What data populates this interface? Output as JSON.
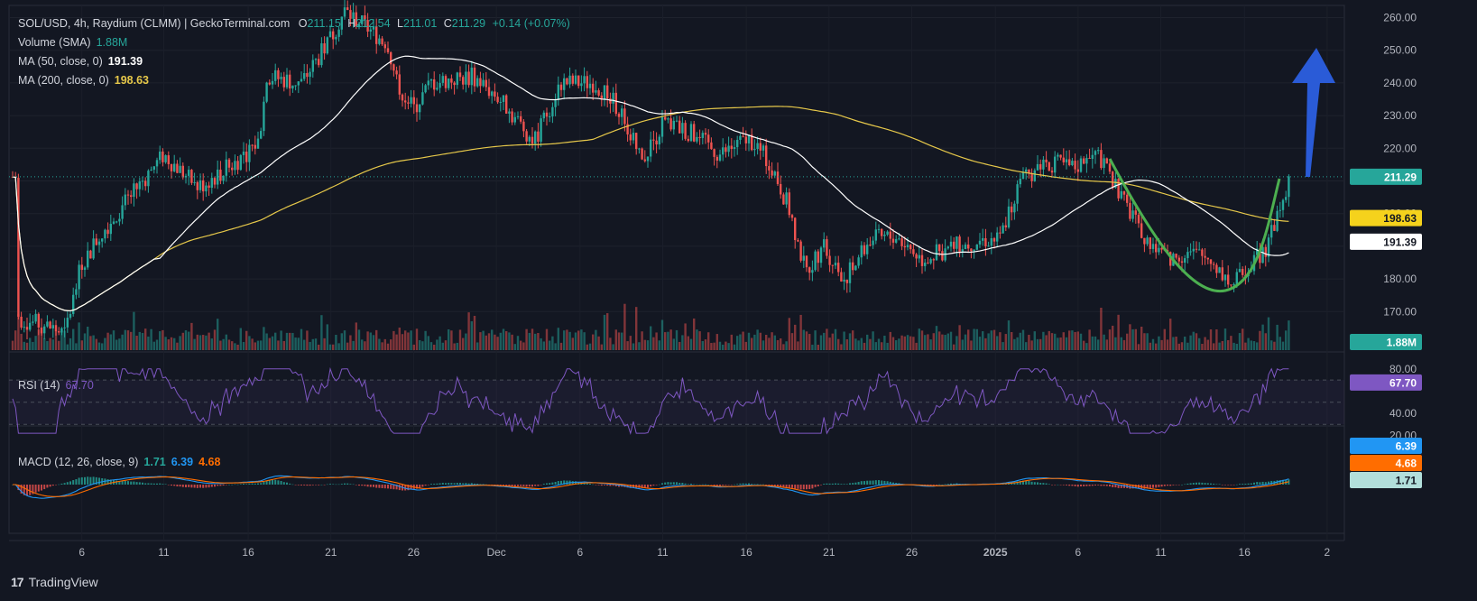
{
  "header": {
    "symbol": "SOL/USD, 4h, Raydium (CLMM) | GeckoTerminal.com",
    "o_label": "O",
    "o_value": "211.15",
    "h_label": "H",
    "h_value": "212.54",
    "l_label": "L",
    "l_value": "211.01",
    "c_label": "C",
    "c_value": "211.29",
    "change": "+0.14 (+0.07%)"
  },
  "legend": {
    "volume_label": "Volume (SMA)",
    "volume_value": "1.88M",
    "ma50_label": "MA (50, close, 0)",
    "ma50_value": "191.39",
    "ma200_label": "MA (200, close, 0)",
    "ma200_value": "198.63",
    "rsi_label": "RSI (14)",
    "rsi_value": "67.70",
    "macd_label": "MACD (12, 26, close, 9)",
    "macd_value": "1.71",
    "signal_value": "6.39",
    "hist_value": "4.68"
  },
  "colors": {
    "background": "#131722",
    "up": "#26a69a",
    "down": "#ef5350",
    "ma50": "#ffffff",
    "ma200": "#e6c84a",
    "rsi": "#7e57c2",
    "macd": "#2196f3",
    "signal": "#ff6d00",
    "arrow": "#2a5bd7",
    "cup": "#4caf50"
  },
  "price_axis": {
    "ticks": [
      "260.00",
      "250.00",
      "240.00",
      "230.00",
      "220.00",
      "210.00",
      "200.00",
      "190.00",
      "180.00",
      "170.00"
    ],
    "badges": {
      "last": "211.29",
      "ma200": "198.63",
      "ma50": "191.39",
      "volume": "1.88M"
    }
  },
  "rsi_axis": {
    "ticks": [
      "80.00",
      "40.00",
      "20.00"
    ],
    "badge": "67.70"
  },
  "macd_axis": {
    "badges": {
      "macd": "6.39",
      "signal": "4.68",
      "hist": "1.71"
    }
  },
  "time_axis": {
    "ticks": [
      "6",
      "11",
      "16",
      "21",
      "26",
      "Dec",
      "6",
      "11",
      "16",
      "21",
      "26",
      "2025",
      "6",
      "11",
      "16",
      "2"
    ]
  },
  "footer": {
    "brand": "TradingView"
  },
  "chart_data": [
    {
      "type": "candlestick",
      "title": "SOL/USD, 4h, Raydium (CLMM) | GeckoTerminal.com",
      "ylim": [
        160,
        262
      ],
      "x_labels": [
        "6",
        "11",
        "16",
        "21",
        "26",
        "Dec",
        "6",
        "11",
        "16",
        "21",
        "26",
        "2025",
        "6",
        "11",
        "16",
        "2"
      ],
      "close_path": [
        {
          "x": "Nov 1",
          "y": 168
        },
        {
          "x": "Nov 3",
          "y": 165
        },
        {
          "x": "Nov 5",
          "y": 163
        },
        {
          "x": "Nov 6",
          "y": 185
        },
        {
          "x": "Nov 8",
          "y": 195
        },
        {
          "x": "Nov 10",
          "y": 205
        },
        {
          "x": "Nov 12",
          "y": 218
        },
        {
          "x": "Nov 14",
          "y": 208
        },
        {
          "x": "Nov 16",
          "y": 215
        },
        {
          "x": "Nov 17",
          "y": 222
        },
        {
          "x": "Nov 18",
          "y": 242
        },
        {
          "x": "Nov 20",
          "y": 240
        },
        {
          "x": "Nov 21",
          "y": 252
        },
        {
          "x": "Nov 22",
          "y": 262
        },
        {
          "x": "Nov 24",
          "y": 252
        },
        {
          "x": "Nov 25",
          "y": 240
        },
        {
          "x": "Nov 26",
          "y": 232
        },
        {
          "x": "Nov 28",
          "y": 240
        },
        {
          "x": "Nov 30",
          "y": 242
        },
        {
          "x": "Dec 2",
          "y": 235
        },
        {
          "x": "Dec 4",
          "y": 222
        },
        {
          "x": "Dec 5",
          "y": 240
        },
        {
          "x": "Dec 7",
          "y": 240
        },
        {
          "x": "Dec 9",
          "y": 232
        },
        {
          "x": "Dec 10",
          "y": 216
        },
        {
          "x": "Dec 11",
          "y": 228
        },
        {
          "x": "Dec 13",
          "y": 225
        },
        {
          "x": "Dec 15",
          "y": 218
        },
        {
          "x": "Dec 17",
          "y": 223
        },
        {
          "x": "Dec 18",
          "y": 215
        },
        {
          "x": "Dec 19",
          "y": 202
        },
        {
          "x": "Dec 20",
          "y": 182
        },
        {
          "x": "Dec 21",
          "y": 190
        },
        {
          "x": "Dec 22",
          "y": 180
        },
        {
          "x": "Dec 24",
          "y": 192
        },
        {
          "x": "Dec 26",
          "y": 193
        },
        {
          "x": "Dec 27",
          "y": 186
        },
        {
          "x": "Dec 29",
          "y": 190
        },
        {
          "x": "Dec 31",
          "y": 192
        },
        {
          "x": "Jan 1",
          "y": 192
        },
        {
          "x": "Jan 2",
          "y": 208
        },
        {
          "x": "Jan 4",
          "y": 216
        },
        {
          "x": "Jan 6",
          "y": 214
        },
        {
          "x": "Jan 7",
          "y": 218
        },
        {
          "x": "Jan 8",
          "y": 203
        },
        {
          "x": "Jan 9",
          "y": 192
        },
        {
          "x": "Jan 10",
          "y": 186
        },
        {
          "x": "Jan 11",
          "y": 188
        },
        {
          "x": "Jan 12",
          "y": 186
        },
        {
          "x": "Jan 13",
          "y": 178
        },
        {
          "x": "Jan 14",
          "y": 186
        },
        {
          "x": "Jan 15",
          "y": 190
        },
        {
          "x": "Jan 16",
          "y": 205
        },
        {
          "x": "Jan 17",
          "y": 211.29
        }
      ]
    }
  ]
}
